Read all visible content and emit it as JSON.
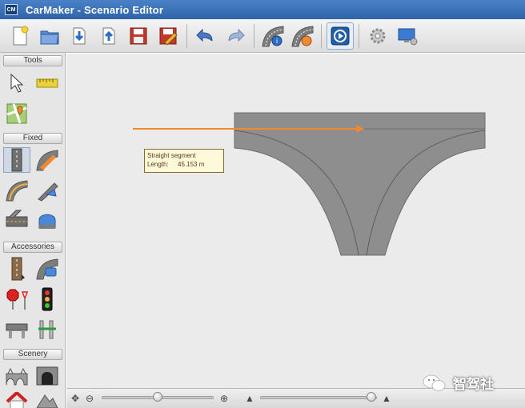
{
  "window": {
    "app_icon": "CM",
    "title": "CarMaker - Scenario Editor"
  },
  "toolbar": {
    "buttons": [
      {
        "icon": "new-file-icon"
      },
      {
        "icon": "open-folder-icon"
      },
      {
        "icon": "import-icon"
      },
      {
        "icon": "export-icon"
      },
      {
        "icon": "save-icon"
      },
      {
        "icon": "save-as-icon"
      },
      {
        "icon": "undo-icon"
      },
      {
        "icon": "redo-icon"
      },
      {
        "icon": "road-info-icon"
      },
      {
        "icon": "road-warning-icon"
      },
      {
        "icon": "play-icon"
      },
      {
        "icon": "settings-gear-icon"
      },
      {
        "icon": "display-settings-icon"
      }
    ]
  },
  "left_panel": {
    "sections": {
      "tools": "Tools",
      "fixed": "Fixed",
      "accessories": "Accessories",
      "scenery": "Scenery"
    }
  },
  "canvas": {
    "tooltip": {
      "title": "Straight segment",
      "length_label": "Length:",
      "length_value": "45.153 m"
    },
    "colors": {
      "road": "#8e8e8e",
      "road_edge": "#6d6d6d",
      "arrow": "#f08a30",
      "background": "#ebebeb"
    }
  },
  "statusbar": {
    "zoom_slider_value": 0.5,
    "second_slider_value": 0.95
  },
  "watermark": {
    "text": "智驾社"
  }
}
